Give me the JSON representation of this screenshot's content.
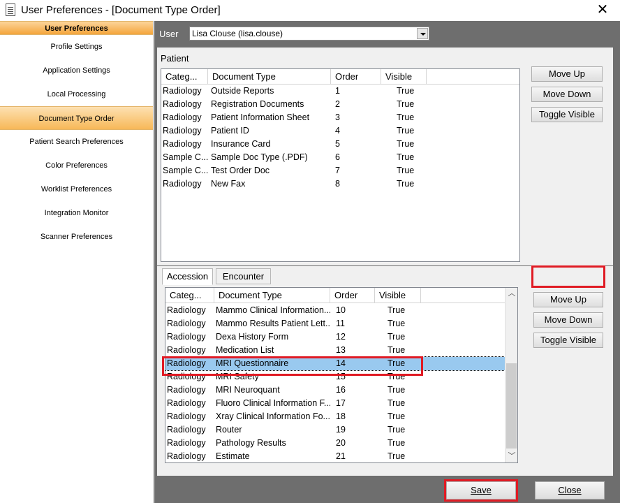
{
  "window": {
    "title": "User Preferences - [Document Type Order]",
    "close_glyph": "✕"
  },
  "sidebar": {
    "header": "User Preferences",
    "items": [
      {
        "label": "Profile Settings",
        "active": false
      },
      {
        "label": "Application Settings",
        "active": false
      },
      {
        "label": "Local Processing",
        "active": false
      },
      {
        "label": "Document Type Order",
        "active": true
      },
      {
        "label": "Patient Search Preferences",
        "active": false
      },
      {
        "label": "Color Preferences",
        "active": false
      },
      {
        "label": "Worklist Preferences",
        "active": false
      },
      {
        "label": "Integration Monitor",
        "active": false
      },
      {
        "label": "Scanner Preferences",
        "active": false
      }
    ]
  },
  "user": {
    "label": "User",
    "value": "Lisa Clouse (lisa.clouse)"
  },
  "patient": {
    "group_label": "Patient",
    "columns": [
      "Categ...",
      "Document Type",
      "Order",
      "Visible"
    ],
    "rows": [
      [
        "Radiology",
        "Outside Reports",
        "1",
        "True"
      ],
      [
        "Radiology",
        "Registration Documents",
        "2",
        "True"
      ],
      [
        "Radiology",
        "Patient Information Sheet",
        "3",
        "True"
      ],
      [
        "Radiology",
        "Patient ID",
        "4",
        "True"
      ],
      [
        "Radiology",
        "Insurance Card",
        "5",
        "True"
      ],
      [
        "Sample C...",
        "Sample Doc Type (.PDF)",
        "6",
        "True"
      ],
      [
        "Sample C...",
        "Test Order Doc",
        "7",
        "True"
      ],
      [
        "Radiology",
        "New Fax",
        "8",
        "True"
      ]
    ],
    "buttons": {
      "move_up": "Move Up",
      "move_down": "Move Down",
      "toggle_visible": "Toggle Visible"
    }
  },
  "accession": {
    "tabs": [
      "Accession",
      "Encounter"
    ],
    "active_tab": "Accession",
    "columns": [
      "Categ...",
      "Document Type",
      "Order",
      "Visible"
    ],
    "rows": [
      [
        "Radiology",
        "Mammo Clinical Information...",
        "10",
        "True"
      ],
      [
        "Radiology",
        "Mammo Results Patient Lett...",
        "11",
        "True"
      ],
      [
        "Radiology",
        "Dexa History Form",
        "12",
        "True"
      ],
      [
        "Radiology",
        "Medication List",
        "13",
        "True"
      ],
      [
        "Radiology",
        "MRI Questionnaire",
        "14",
        "True"
      ],
      [
        "Radiology",
        "MRI Safety",
        "15",
        "True"
      ],
      [
        "Radiology",
        "MRI Neuroquant",
        "16",
        "True"
      ],
      [
        "Radiology",
        "Fluoro Clinical Information F...",
        "17",
        "True"
      ],
      [
        "Radiology",
        "Xray Clinical Information Fo...",
        "18",
        "True"
      ],
      [
        "Radiology",
        "Router",
        "19",
        "True"
      ],
      [
        "Radiology",
        "Pathology Results",
        "20",
        "True"
      ],
      [
        "Radiology",
        "Estimate",
        "21",
        "True"
      ]
    ],
    "selected_row_index": 4,
    "buttons": {
      "move_up": "Move Up",
      "move_down": "Move Down",
      "toggle_visible": "Toggle Visible"
    }
  },
  "footer": {
    "save": "Save",
    "close": "Close"
  },
  "colors": {
    "highlight": "#e01b24",
    "selection": "#99c9ef",
    "sidebar_accent": "#f4a53c",
    "main_bg": "#6e6e6e"
  },
  "icons": {
    "window_icon": "document-icon",
    "dropdown": "chevron-down-icon",
    "scroll_up": "chevron-up-icon",
    "scroll_down": "chevron-down-icon"
  }
}
